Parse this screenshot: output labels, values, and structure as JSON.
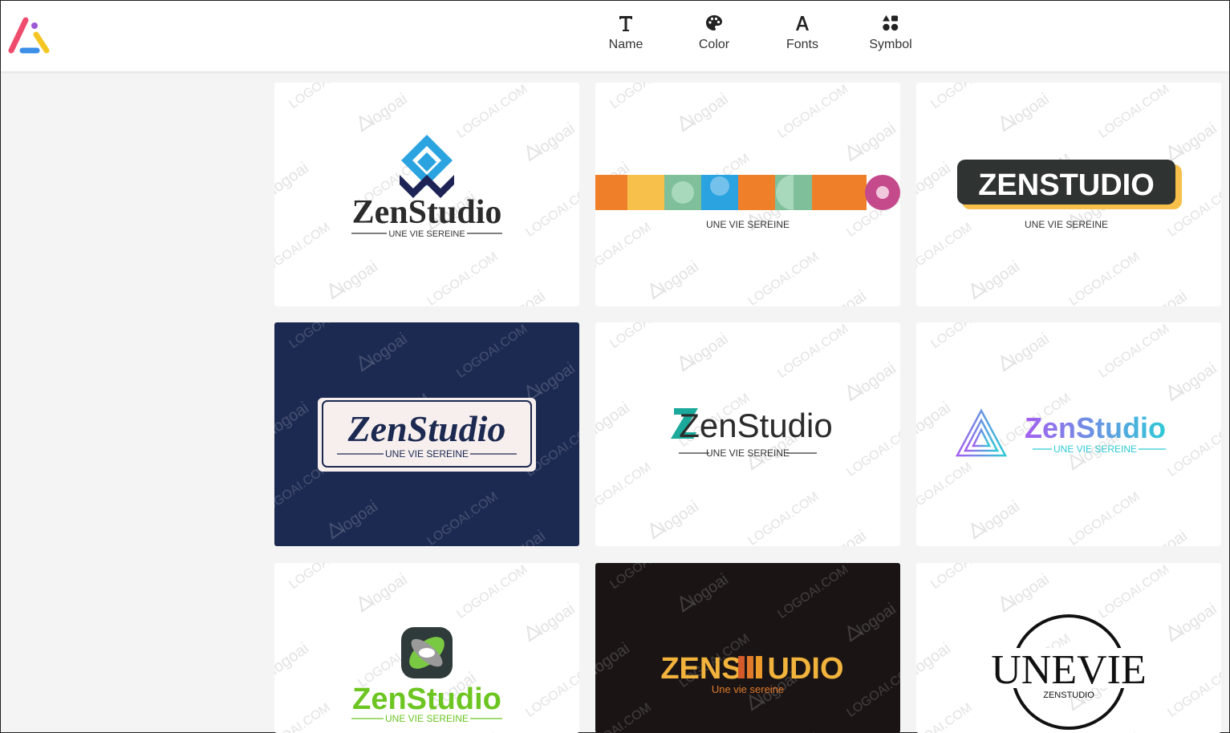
{
  "toolbar": {
    "items": [
      {
        "label": "Name",
        "icon": "text-icon"
      },
      {
        "label": "Color",
        "icon": "palette-icon"
      },
      {
        "label": "Fonts",
        "icon": "font-icon"
      },
      {
        "label": "Symbol",
        "icon": "shapes-icon"
      }
    ]
  },
  "watermark": {
    "text1": "LOGOAI.COM",
    "text2": "logoai"
  },
  "logos": [
    {
      "name": "ZenStudio",
      "tagline": "UNE VIE SEREINE",
      "background": "#ffffff"
    },
    {
      "name": "ZENSTUDIO",
      "tagline": "UNE VIE SEREINE",
      "background": "#ffffff"
    },
    {
      "name": "ZENSTUDIO",
      "tagline": "UNE VIE SEREINE",
      "background": "#ffffff"
    },
    {
      "name": "ZenStudio",
      "tagline": "UNE VIE SEREINE",
      "background": "#1c2951"
    },
    {
      "name": "ZenStudio",
      "tagline": "UNE VIE SEREINE",
      "background": "#ffffff"
    },
    {
      "name": "ZenStudio",
      "tagline": "UNE VIE SEREINE",
      "background": "#ffffff"
    },
    {
      "name": "ZenStudio",
      "tagline": "UNE VIE SEREINE",
      "background": "#ffffff"
    },
    {
      "name_a": "ZENS",
      "name_b": "UDIO",
      "tagline": "Une vie sereine",
      "background": "#1a1414"
    },
    {
      "name": "UNEVIE",
      "tagline": "ZENSTUDIO",
      "background": "#ffffff"
    }
  ],
  "colors": {
    "accent_pink": "#ef4b6c",
    "accent_blue": "#3b8fe8",
    "accent_yellow": "#f5c623"
  }
}
